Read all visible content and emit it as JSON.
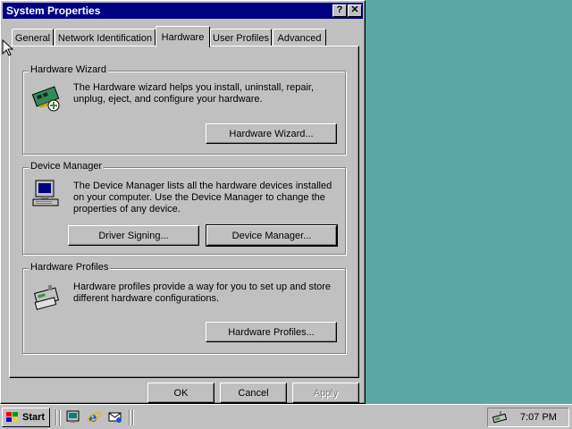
{
  "window": {
    "title": "System Properties",
    "help_glyph": "?",
    "close_glyph": "✕"
  },
  "tabs": [
    {
      "label": "General"
    },
    {
      "label": "Network Identification"
    },
    {
      "label": "Hardware",
      "active": true
    },
    {
      "label": "User Profiles"
    },
    {
      "label": "Advanced"
    }
  ],
  "hardware_wizard": {
    "title": "Hardware Wizard",
    "description_line1": "The Hardware wizard helps you install, uninstall, repair,",
    "description_line2": "unplug, eject, and configure your hardware.",
    "button": "Hardware Wizard...",
    "icon": "hardware-wizard-icon"
  },
  "device_manager": {
    "title": "Device Manager",
    "description_line1": "The Device Manager lists all the hardware devices installed",
    "description_line2": "on your computer. Use the Device Manager to change the",
    "description_line3": "properties of any device.",
    "driver_signing_button": "Driver Signing...",
    "button": "Device Manager...",
    "icon": "computer-icon"
  },
  "hardware_profiles": {
    "title": "Hardware Profiles",
    "description_line1": "Hardware profiles provide a way for you to set up and store",
    "description_line2": "different hardware configurations.",
    "button": "Hardware Profiles...",
    "icon": "hardware-profiles-icon"
  },
  "footer": {
    "ok": "OK",
    "cancel": "Cancel",
    "apply": "Apply"
  },
  "taskbar": {
    "start_label": "Start",
    "clock": "7:07 PM",
    "quick_launch": [
      "desktop-icon",
      "internet-explorer-icon",
      "outlook-express-icon"
    ]
  },
  "colors": {
    "desktop": "#5aa7a8",
    "title_bar": "#000080",
    "face": "#c0c0c0"
  }
}
